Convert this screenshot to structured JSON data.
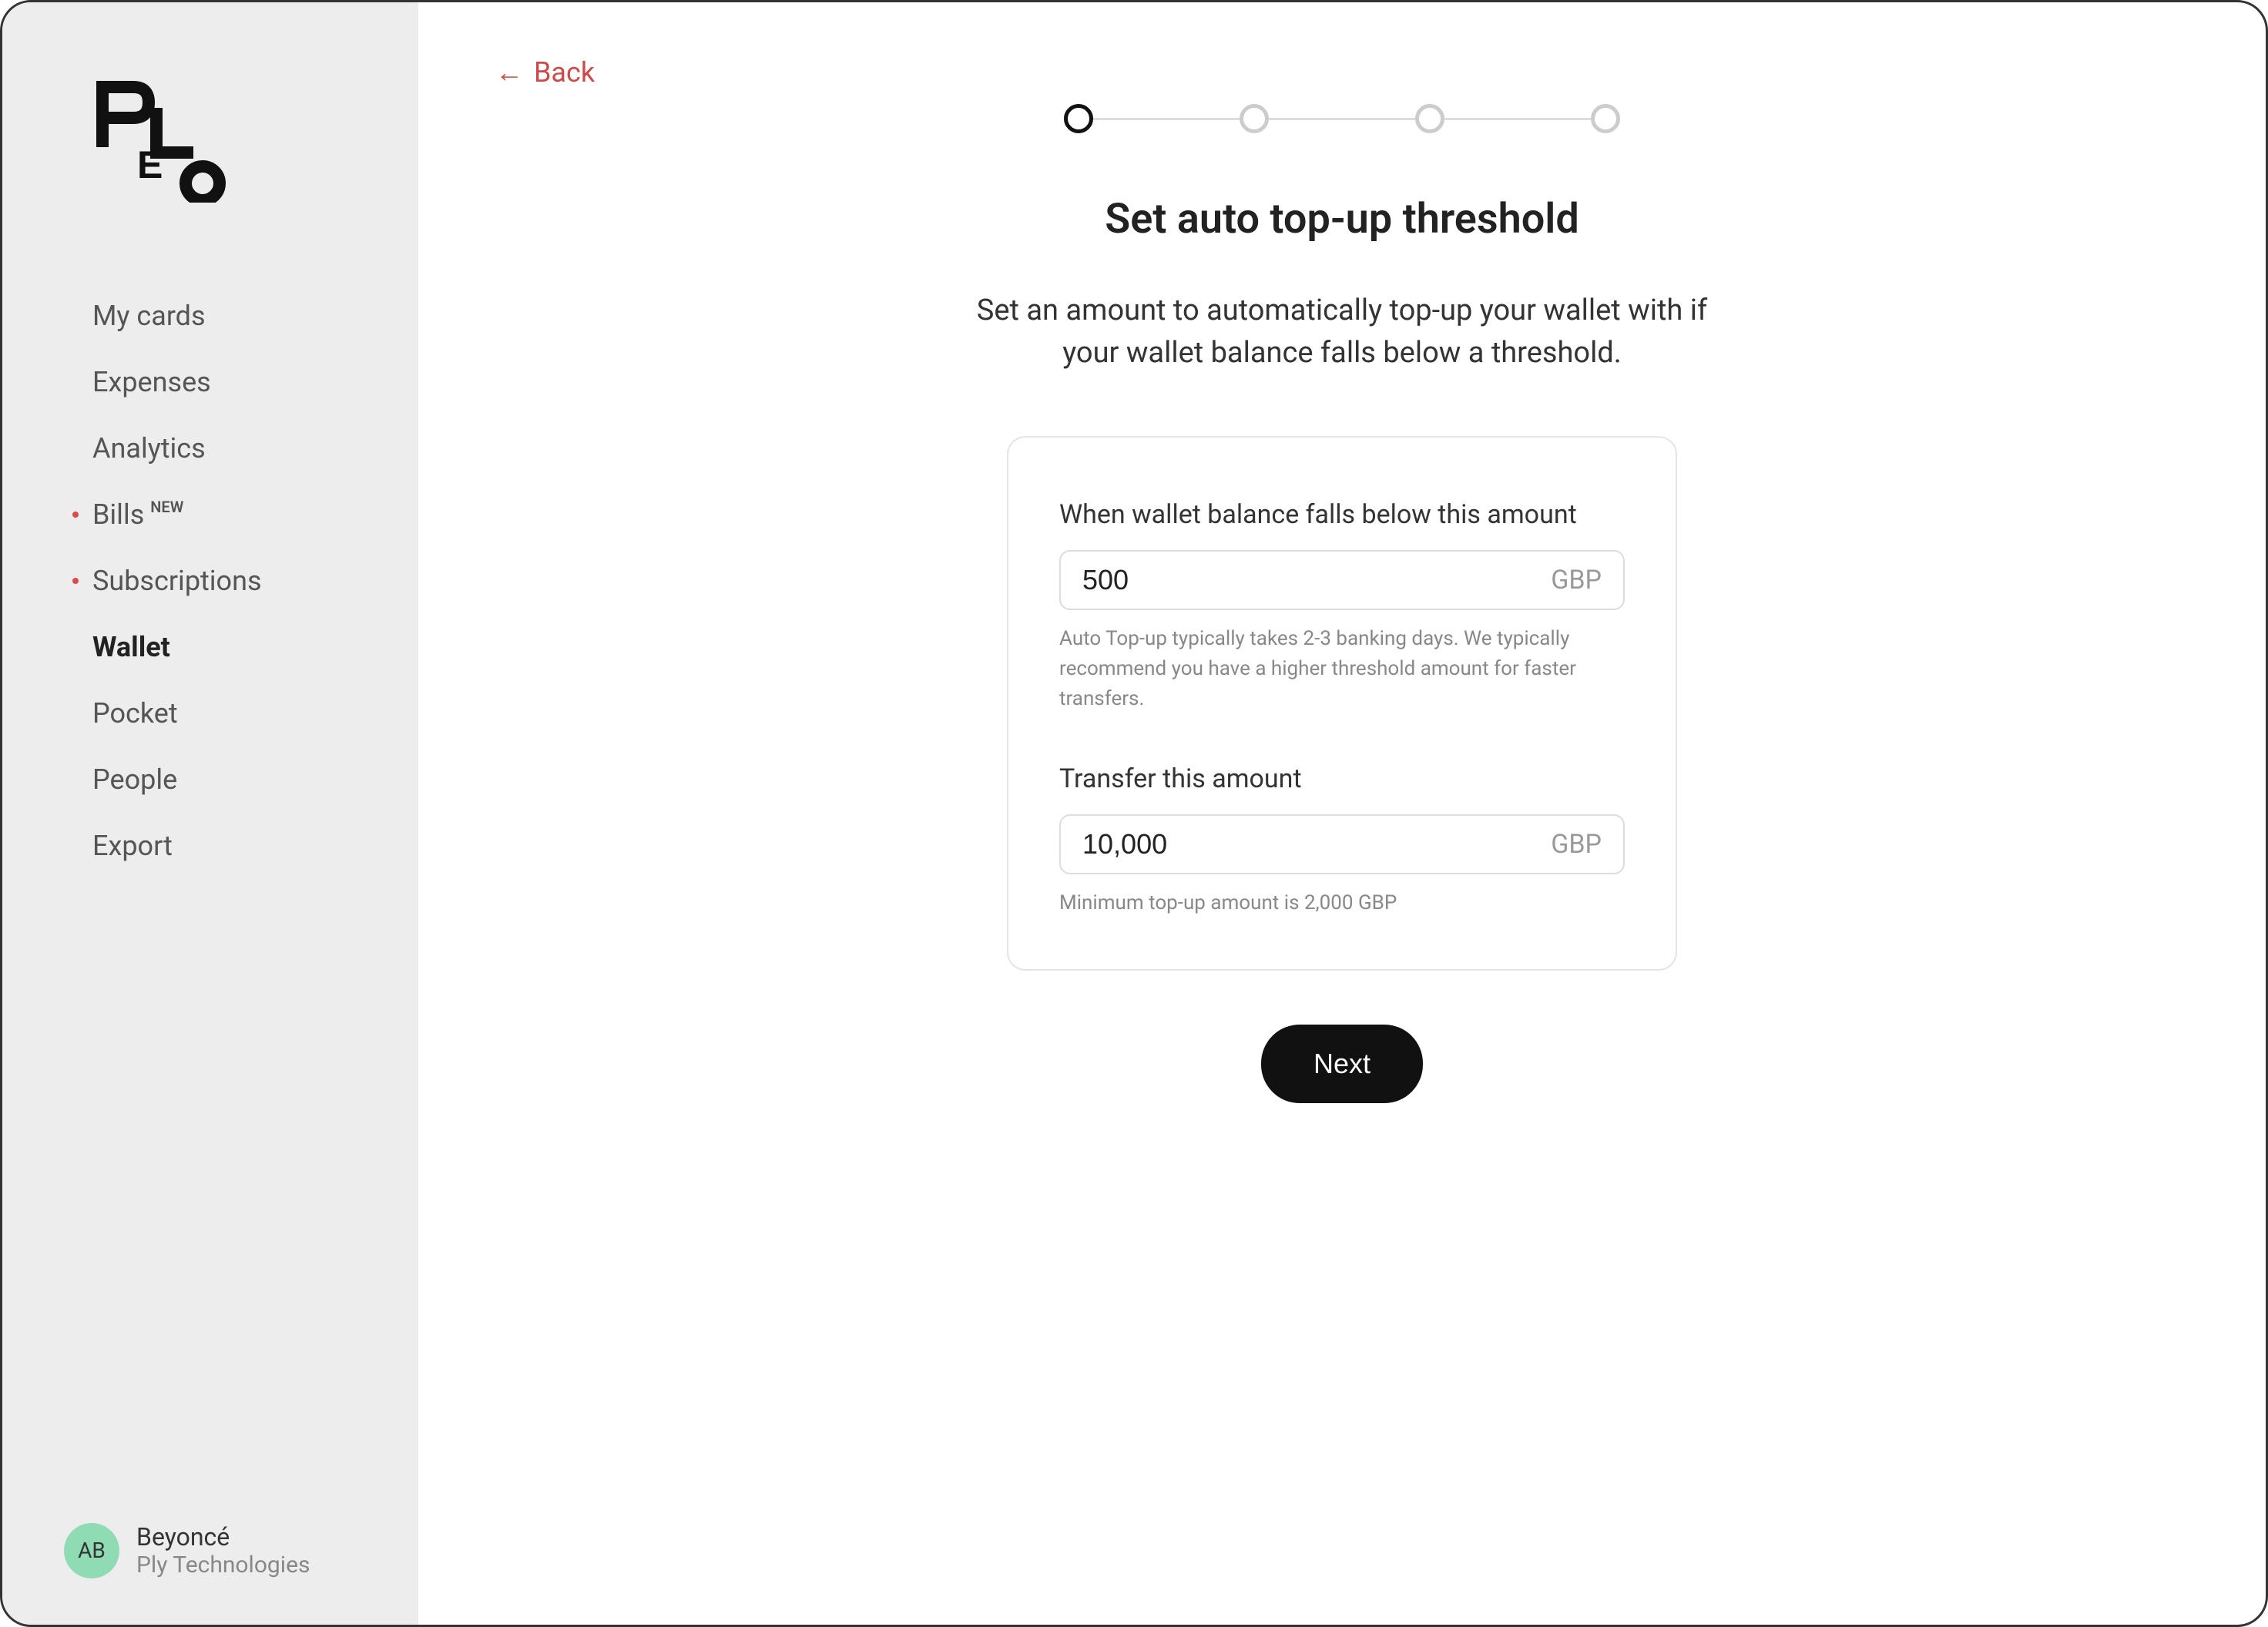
{
  "sidebar": {
    "nav_items": [
      {
        "label": "My cards",
        "has_dot": false,
        "has_new": false,
        "active": false
      },
      {
        "label": "Expenses",
        "has_dot": false,
        "has_new": false,
        "active": false
      },
      {
        "label": "Analytics",
        "has_dot": false,
        "has_new": false,
        "active": false
      },
      {
        "label": "Bills",
        "has_dot": true,
        "has_new": true,
        "new_text": "NEW",
        "active": false
      },
      {
        "label": "Subscriptions",
        "has_dot": true,
        "has_new": false,
        "active": false
      },
      {
        "label": "Wallet",
        "has_dot": false,
        "has_new": false,
        "active": true
      },
      {
        "label": "Pocket",
        "has_dot": false,
        "has_new": false,
        "active": false
      },
      {
        "label": "People",
        "has_dot": false,
        "has_new": false,
        "active": false
      },
      {
        "label": "Export",
        "has_dot": false,
        "has_new": false,
        "active": false
      }
    ],
    "user": {
      "initials": "AB",
      "name": "Beyoncé",
      "company": "Ply Technologies"
    }
  },
  "header": {
    "back_label": "Back"
  },
  "stepper": {
    "total_steps": 4,
    "current_step": 1
  },
  "page": {
    "title": "Set auto top-up threshold",
    "description": "Set an amount to automatically top-up your wallet with if your wallet balance falls below a threshold."
  },
  "form": {
    "threshold": {
      "label": "When wallet balance falls below this amount",
      "value": "500",
      "currency": "GBP",
      "hint": "Auto Top-up typically takes 2-3 banking days. We typically recommend you have a higher threshold amount for faster transfers."
    },
    "transfer": {
      "label": "Transfer this amount",
      "value": "10,000",
      "currency": "GBP",
      "hint": "Minimum top-up amount is 2,000 GBP"
    }
  },
  "actions": {
    "next_label": "Next"
  }
}
